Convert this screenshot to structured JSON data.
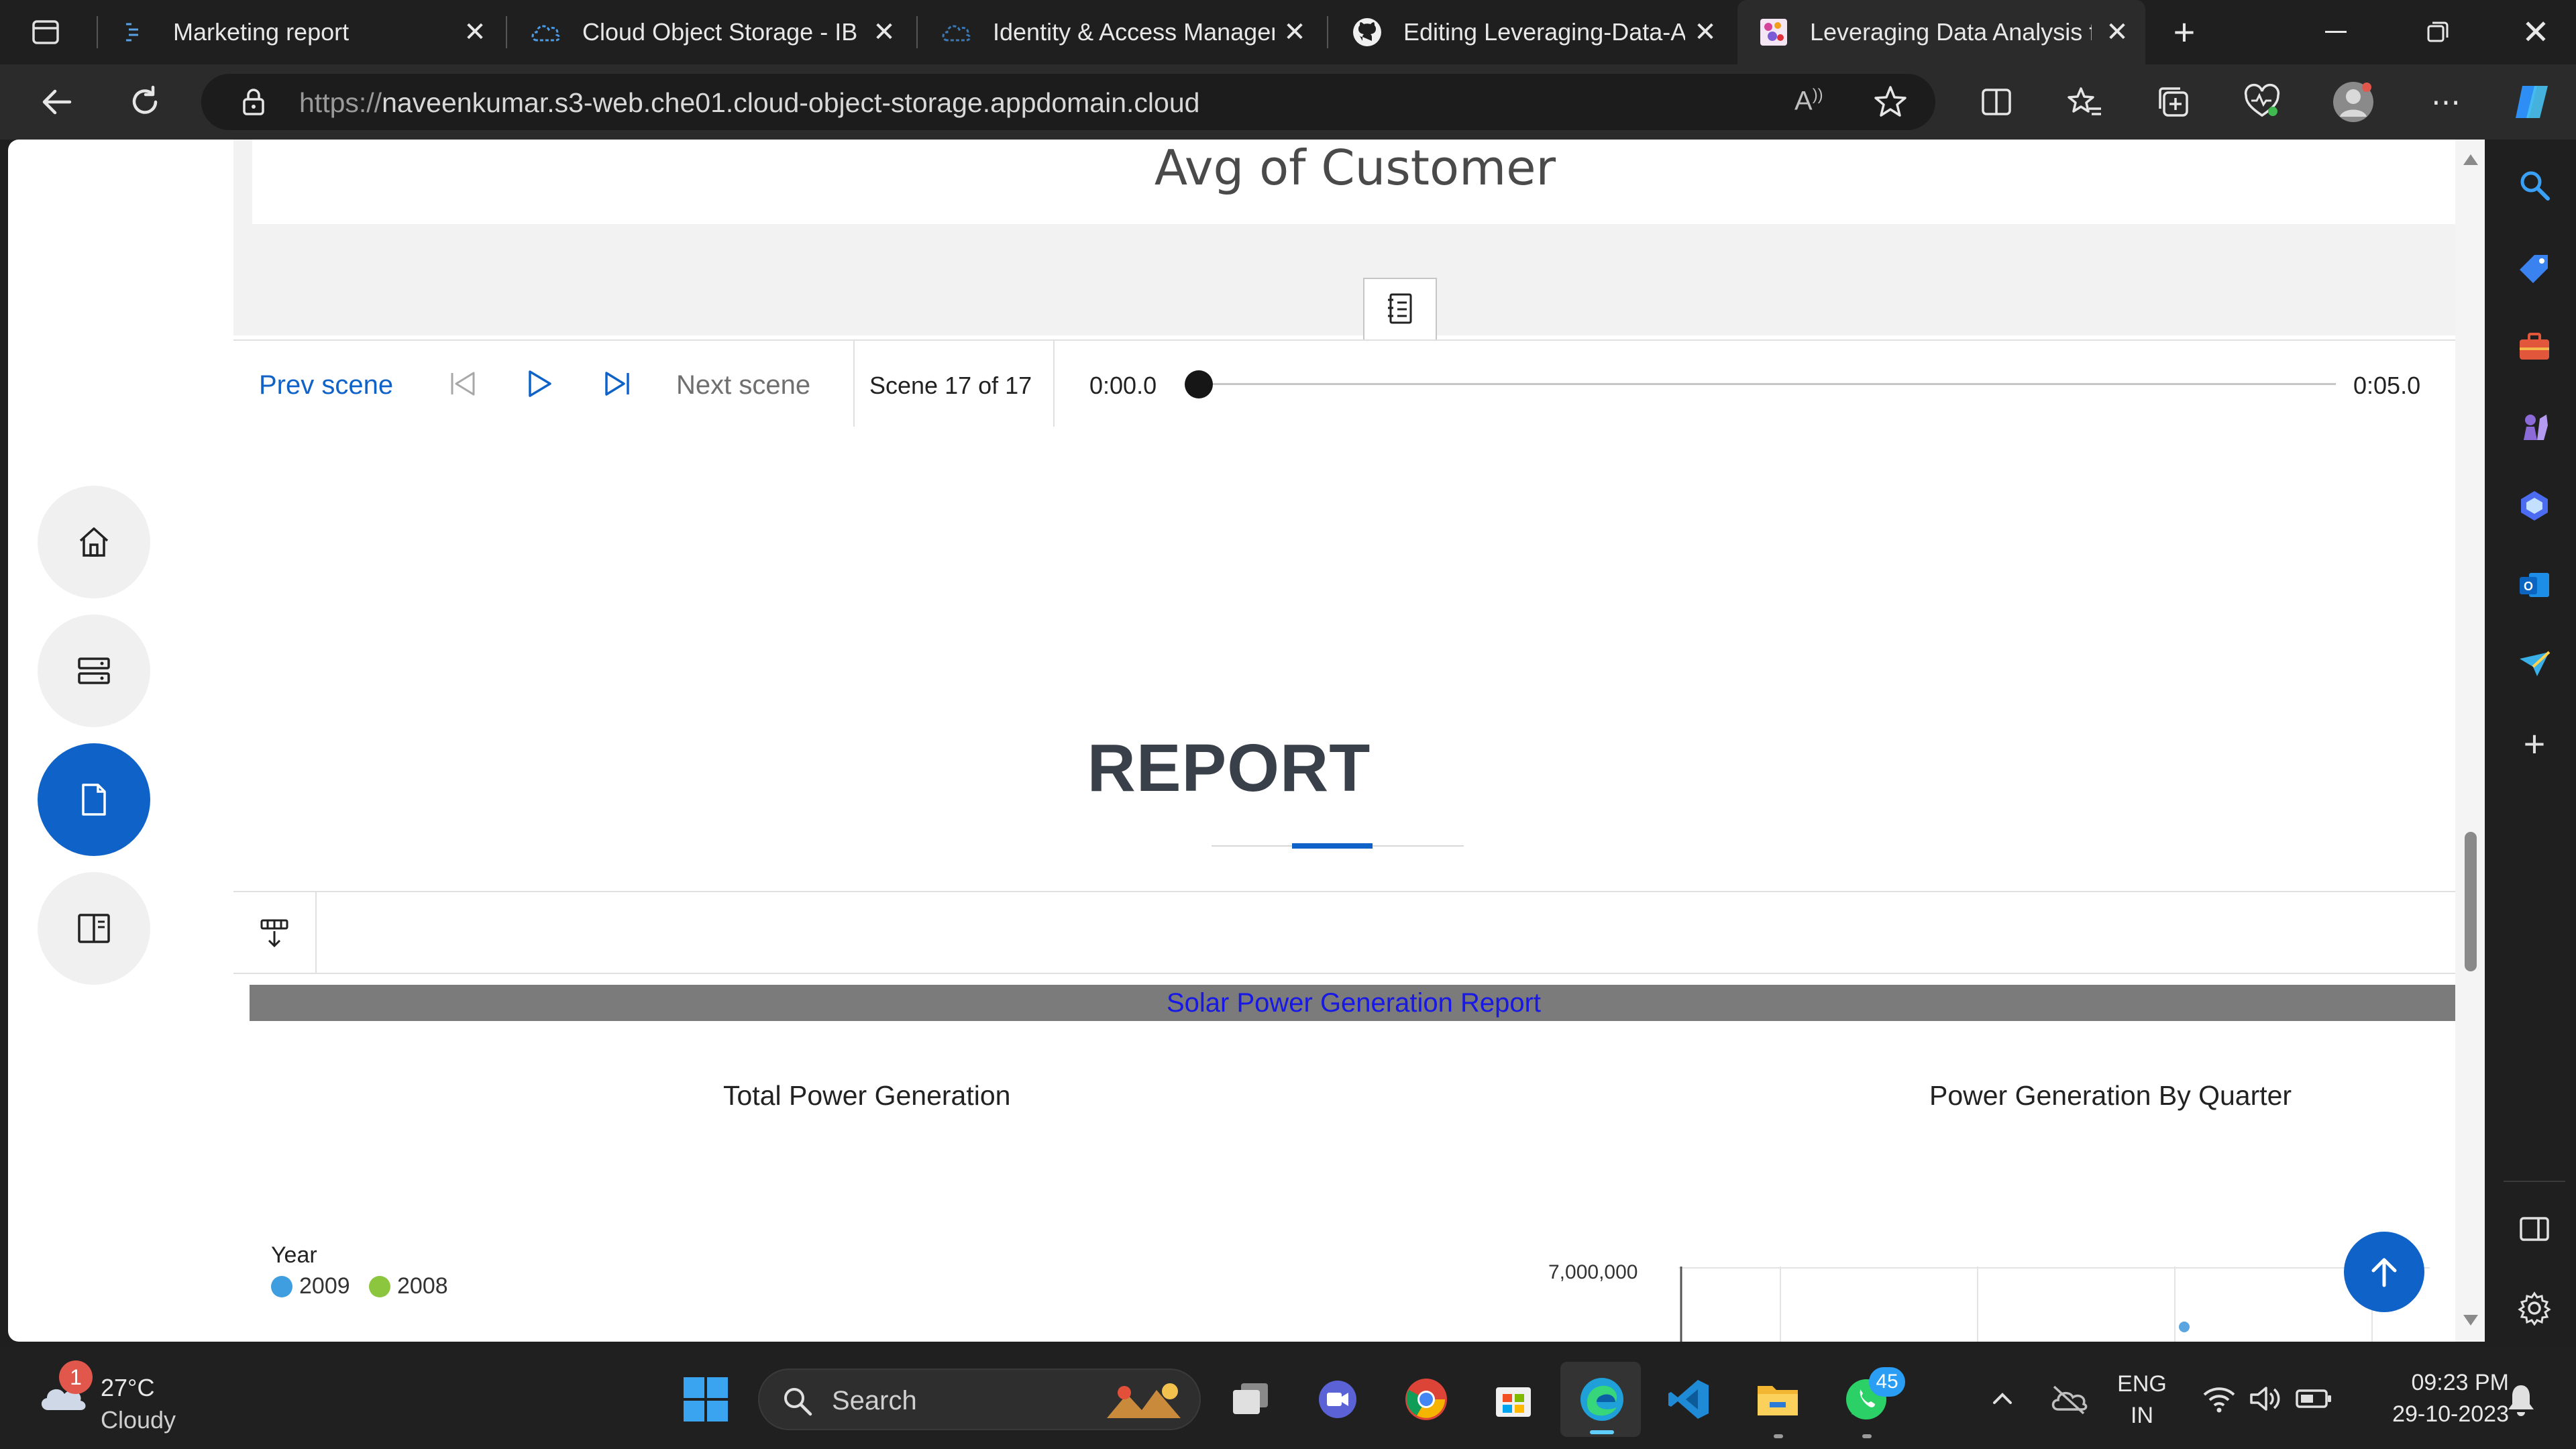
{
  "browser": {
    "tabs": [
      {
        "title": "Marketing report",
        "icon": "list-icon"
      },
      {
        "title": "Cloud Object Storage - IBM",
        "icon": "ibm-cloud-icon"
      },
      {
        "title": "Identity & Access Management",
        "icon": "ibm-cloud-icon"
      },
      {
        "title": "Editing Leveraging-Data-Analysis",
        "icon": "github-icon"
      },
      {
        "title": "Leveraging Data Analysis for",
        "icon": "app-favicon-icon"
      }
    ],
    "url_prefix": "https://",
    "url_host": "naveenkumar.s3-web.che01.cloud-object-storage.appdomain.cloud"
  },
  "story": {
    "visual_title": "Avg of Customer",
    "player": {
      "prev": "Prev scene",
      "next": "Next scene",
      "scene": "Scene 17 of 17",
      "time_start": "0:00.0",
      "time_end": "0:05.0",
      "progress": 0
    }
  },
  "report": {
    "heading": "REPORT",
    "banner": "Solar Power Generation Report",
    "chart_left_title": "Total Power Generation",
    "chart_right_title": "Power Generation By Quarter",
    "legend_title": "Year",
    "legend": [
      {
        "label": "2009",
        "color": "#3f9ee0"
      },
      {
        "label": "2008",
        "color": "#8cc63f"
      }
    ],
    "y_tick": "7,000,000"
  },
  "chart_data": {
    "type": "bar",
    "title": "Power Generation By Quarter",
    "yticks": [
      "7,000,000"
    ],
    "series": [
      {
        "name": "2009",
        "color": "#3f9ee0"
      },
      {
        "name": "2008",
        "color": "#8cc63f"
      }
    ]
  },
  "taskbar": {
    "weather_temp": "27°C",
    "weather_cond": "Cloudy",
    "weather_badge": "1",
    "search": "Search",
    "whatsapp_badge": "45",
    "lang1": "ENG",
    "lang2": "IN",
    "time": "09:23 PM",
    "date": "29-10-2023"
  },
  "colors": {
    "accent": "#0f62c8",
    "banner": "#7b7b7b",
    "banner_text": "#1717e6"
  }
}
